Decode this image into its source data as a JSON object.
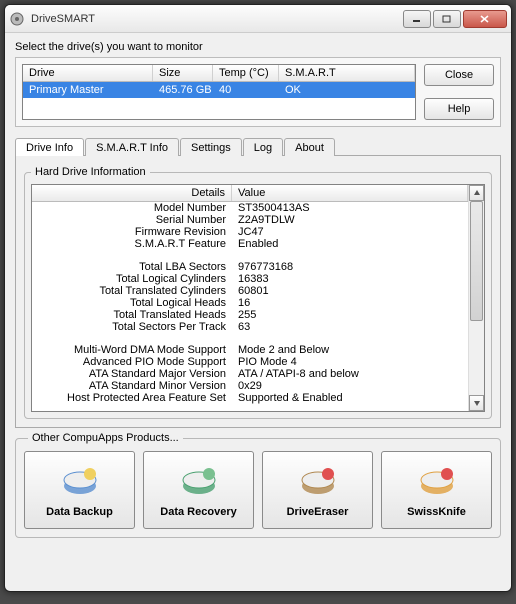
{
  "window": {
    "title": "DriveSMART"
  },
  "instruction": "Select the drive(s) you want to monitor",
  "buttons": {
    "close": "Close",
    "help": "Help"
  },
  "drive_table": {
    "headers": {
      "drive": "Drive",
      "size": "Size",
      "temp": "Temp (°C)",
      "smart": "S.M.A.R.T"
    },
    "rows": [
      {
        "drive": "Primary Master",
        "size": "465.76 GB",
        "temp": "40",
        "smart": "OK"
      }
    ]
  },
  "tabs": [
    {
      "label": "Drive Info",
      "active": true
    },
    {
      "label": "S.M.A.R.T Info",
      "active": false
    },
    {
      "label": "Settings",
      "active": false
    },
    {
      "label": "Log",
      "active": false
    },
    {
      "label": "About",
      "active": false
    }
  ],
  "group_title": "Hard Drive Information",
  "detail_headers": {
    "details": "Details",
    "value": "Value"
  },
  "details": [
    {
      "label": "Model Number",
      "value": "ST3500413AS"
    },
    {
      "label": "Serial Number",
      "value": "Z2A9TDLW"
    },
    {
      "label": "Firmware Revision",
      "value": "JC47"
    },
    {
      "label": "S.M.A.R.T Feature",
      "value": "Enabled"
    },
    {
      "label": "",
      "value": ""
    },
    {
      "label": "Total LBA Sectors",
      "value": "976773168"
    },
    {
      "label": "Total Logical Cylinders",
      "value": "16383"
    },
    {
      "label": "Total Translated Cylinders",
      "value": "60801"
    },
    {
      "label": "Total Logical Heads",
      "value": "16"
    },
    {
      "label": "Total Translated Heads",
      "value": "255"
    },
    {
      "label": "Total Sectors Per Track",
      "value": "63"
    },
    {
      "label": "",
      "value": ""
    },
    {
      "label": "Multi-Word DMA Mode Support",
      "value": "Mode 2 and Below"
    },
    {
      "label": "Advanced PIO Mode Support",
      "value": "PIO Mode 4"
    },
    {
      "label": "ATA Standard Major Version",
      "value": "ATA / ATAPI-8 and below"
    },
    {
      "label": "ATA Standard Minor Version",
      "value": "0x29"
    },
    {
      "label": "Host Protected Area Feature Set",
      "value": "Supported & Enabled"
    }
  ],
  "products_title": "Other CompuApps Products...",
  "products": [
    {
      "label": "Data Backup",
      "icon": "disk-backup",
      "color1": "#5a8fd0",
      "color2": "#f0d060"
    },
    {
      "label": "Data Recovery",
      "icon": "disk-recovery",
      "color1": "#4aa070",
      "color2": "#7ac090"
    },
    {
      "label": "DriveEraser",
      "icon": "disk-eraser",
      "color1": "#b08850",
      "color2": "#e05050"
    },
    {
      "label": "SwissKnife",
      "icon": "swissknife",
      "color1": "#e0a040",
      "color2": "#e05050"
    }
  ]
}
